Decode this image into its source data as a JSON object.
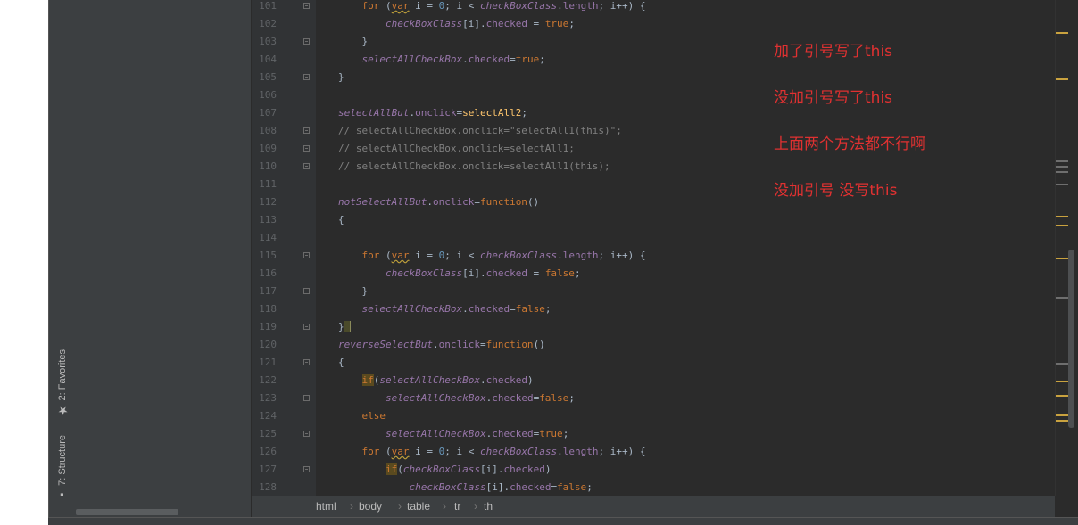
{
  "sidebar": {
    "favorites_label": "2: Favorites",
    "structure_label": "7: Structure"
  },
  "editor": {
    "line_numbers": [
      "101",
      "102",
      "103",
      "104",
      "105",
      "106",
      "107",
      "108",
      "109",
      "110",
      "111",
      "112",
      "113",
      "114",
      "115",
      "116",
      "117",
      "118",
      "119",
      "120",
      "121",
      "122",
      "123",
      "124",
      "125",
      "126",
      "127",
      "128"
    ]
  },
  "annotations": {
    "note1": "加了引号写了this",
    "note2": "没加引号写了this",
    "note3": "上面两个方法都不行啊",
    "note4": "没加引号 没写this"
  },
  "breadcrumb": [
    "html",
    "body",
    "table",
    "tr",
    "th"
  ],
  "colors": {
    "annotation_red": "#e03131",
    "editor_bg": "#2b2b2b",
    "keyword": "#cc7832",
    "field": "#9876aa",
    "string": "#6a8759",
    "number": "#6897bb",
    "function": "#ffc66d",
    "comment": "#808080"
  }
}
